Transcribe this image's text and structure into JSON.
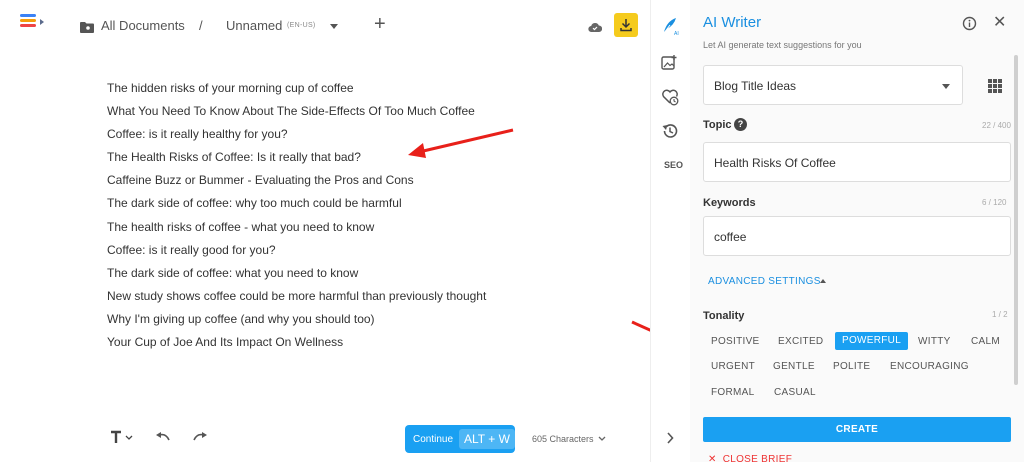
{
  "topbar": {
    "breadcrumb_root": "All Documents",
    "separator": "/",
    "doc_name": "Unnamed",
    "locale": "(EN-US)",
    "plus": "+"
  },
  "editor": {
    "lines": [
      "The hidden risks of your morning cup of coffee",
      "What You Need To Know About The Side-Effects Of Too Much Coffee",
      "Coffee: is it really healthy for you?",
      "The Health Risks of Coffee: Is it really that bad?",
      "Caffeine Buzz or Bummer - Evaluating the Pros and Cons",
      "The dark side of coffee: why too much could be harmful",
      "The health risks of coffee - what you need to know",
      "Coffee: is it really good for you?",
      "The dark side of coffee: what you need to know",
      "New study shows coffee could be more harmful than previously thought",
      "Why I'm giving up coffee (and why you should too)",
      "Your Cup of Joe And Its Impact On Wellness"
    ],
    "continue_label": "Continue",
    "shortcut": "ALT + W",
    "char_count": "605 Characters"
  },
  "rail": {
    "seo_label": "SEO"
  },
  "panel": {
    "title": "AI Writer",
    "subtitle": "Let AI generate text suggestions for you",
    "template_select": "Blog Title Ideas",
    "topic_label": "Topic",
    "topic_counter": "22 / 400",
    "topic_value": "Health Risks Of Coffee",
    "keywords_label": "Keywords",
    "keywords_counter": "6 / 120",
    "keywords_value": "coffee",
    "advanced_settings": "ADVANCED SETTINGS",
    "tonality_label": "Tonality",
    "tonality_counter": "1 / 2",
    "tones": [
      {
        "label": "POSITIVE",
        "active": false
      },
      {
        "label": "EXCITED",
        "active": false
      },
      {
        "label": "POWERFUL",
        "active": true
      },
      {
        "label": "WITTY",
        "active": false
      },
      {
        "label": "CALM",
        "active": false
      },
      {
        "label": "URGENT",
        "active": false
      },
      {
        "label": "GENTLE",
        "active": false
      },
      {
        "label": "POLITE",
        "active": false
      },
      {
        "label": "ENCOURAGING",
        "active": false
      },
      {
        "label": "FORMAL",
        "active": false
      },
      {
        "label": "CASUAL",
        "active": false
      }
    ],
    "create_label": "CREATE",
    "close_brief": "CLOSE BRIEF"
  },
  "colors": {
    "accent": "#1aa0f2",
    "download": "#f5cb1d",
    "annotation_arrow": "#e8201a"
  }
}
